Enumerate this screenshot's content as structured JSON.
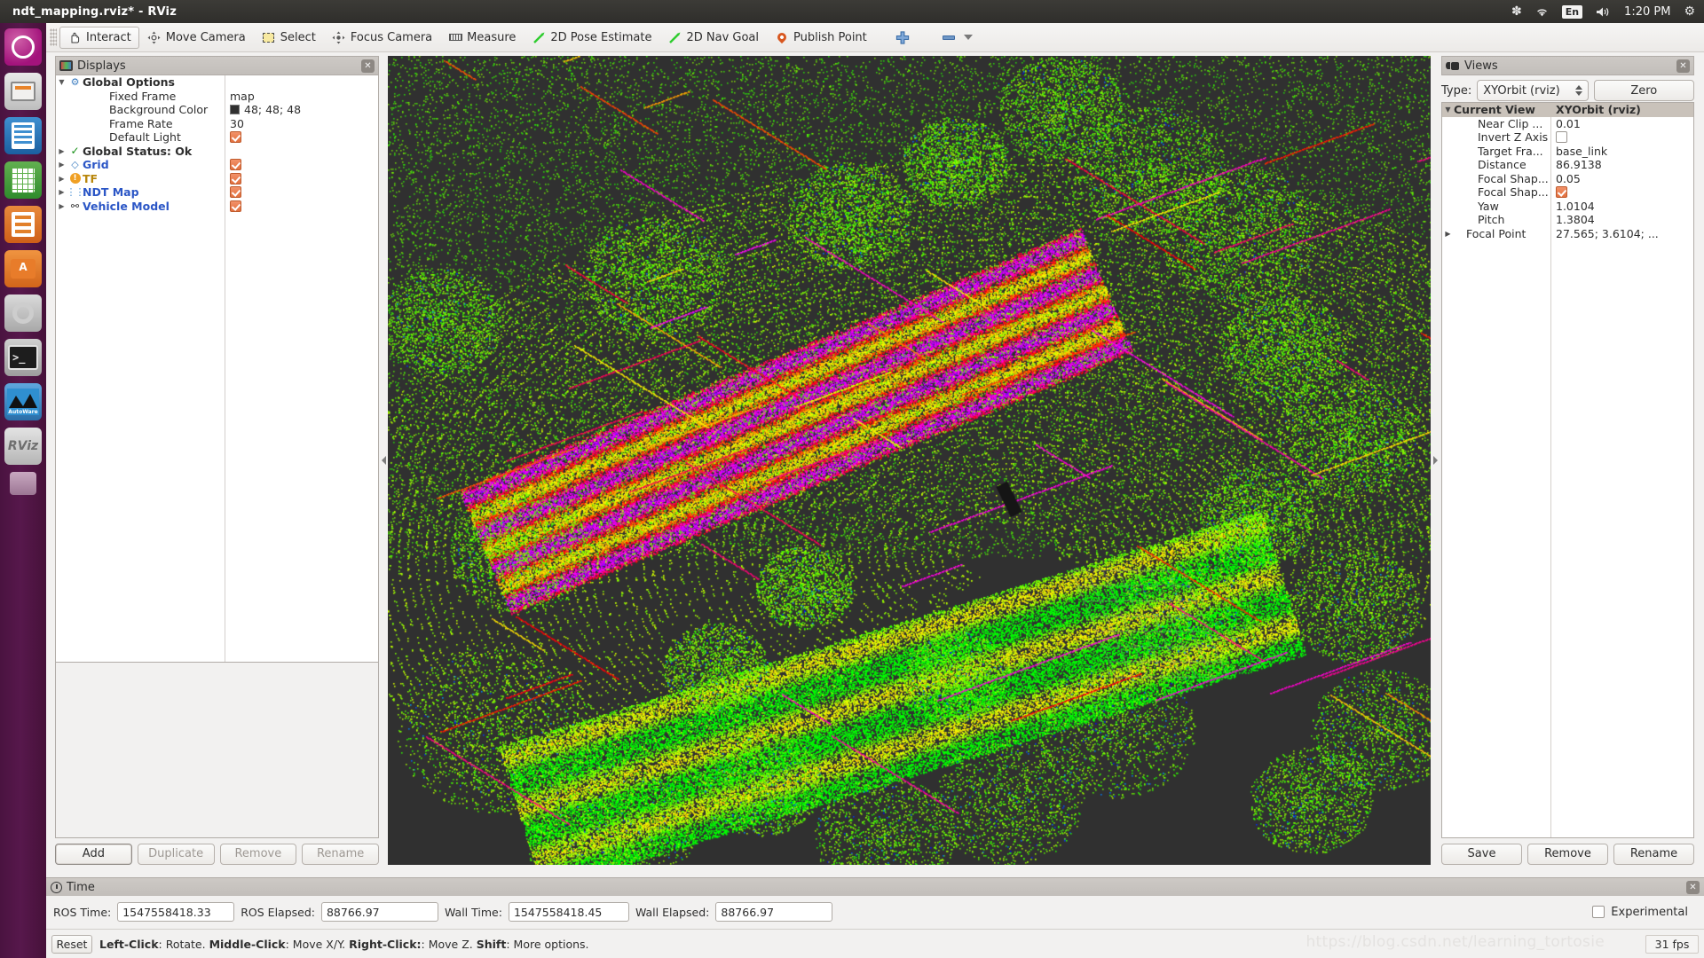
{
  "window": {
    "title": "ndt_mapping.rviz* - RViz"
  },
  "tray": {
    "items": [
      {
        "name": "sys-menu-icon",
        "glyph": "✽"
      },
      {
        "name": "wifi-icon",
        "glyph": "◔"
      },
      {
        "name": "keyboard-layout-indicator",
        "glyph": "En"
      },
      {
        "name": "volume-icon",
        "glyph": "🔊"
      }
    ],
    "clock": "1:20 PM",
    "session_icon": "⚙"
  },
  "launcher": {
    "items": [
      {
        "name": "ubuntu-dash-icon",
        "label": "Ubuntu"
      },
      {
        "name": "files-icon",
        "label": "Files"
      },
      {
        "name": "libreoffice-writer-icon",
        "label": "LibreOffice Writer"
      },
      {
        "name": "libreoffice-calc-icon",
        "label": "LibreOffice Calc"
      },
      {
        "name": "libreoffice-impress-icon",
        "label": "LibreOffice Impress"
      },
      {
        "name": "software-center-icon",
        "label": "Ubuntu Software"
      },
      {
        "name": "system-settings-icon",
        "label": "System Settings"
      },
      {
        "name": "terminal-icon",
        "label": "Terminal"
      },
      {
        "name": "autoware-icon",
        "label": "AutoWare"
      },
      {
        "name": "rviz-icon",
        "label": "RViz"
      },
      {
        "name": "screenshot-icon",
        "label": "Screenshot"
      }
    ]
  },
  "toolbar": {
    "buttons": [
      {
        "name": "tool-interact",
        "label": "Interact",
        "icon": "hand-icon",
        "active": true
      },
      {
        "name": "tool-move-camera",
        "label": "Move Camera",
        "icon": "move-camera-icon",
        "active": false
      },
      {
        "name": "tool-select",
        "label": "Select",
        "icon": "select-icon",
        "active": false
      },
      {
        "name": "tool-focus-camera",
        "label": "Focus Camera",
        "icon": "focus-camera-icon",
        "active": false
      },
      {
        "name": "tool-measure",
        "label": "Measure",
        "icon": "ruler-icon",
        "active": false
      },
      {
        "name": "tool-2d-pose-estimate",
        "label": "2D Pose Estimate",
        "icon": "green-arrow-icon",
        "active": false
      },
      {
        "name": "tool-2d-nav-goal",
        "label": "2D Nav Goal",
        "icon": "green-arrow-icon",
        "active": false
      },
      {
        "name": "tool-publish-point",
        "label": "Publish Point",
        "icon": "map-pin-icon",
        "active": false
      }
    ],
    "add_tool_label": "+",
    "remove_tool_label": "-"
  },
  "displays": {
    "title": "Displays",
    "close_label": "✕",
    "tree": [
      {
        "name": "global-options",
        "expander": "▼",
        "icon": "gear-icon",
        "label": "Global Options",
        "style": "bold",
        "value": "",
        "value_type": "none",
        "indent": false
      },
      {
        "name": "fixed-frame",
        "expander": "",
        "icon": "",
        "label": "Fixed Frame",
        "style": "plain",
        "value": "map",
        "value_type": "text",
        "indent": true
      },
      {
        "name": "background-color",
        "expander": "",
        "icon": "",
        "label": "Background Color",
        "style": "plain",
        "value": "48; 48; 48",
        "value_type": "color",
        "color": "#303030",
        "indent": true
      },
      {
        "name": "frame-rate",
        "expander": "",
        "icon": "",
        "label": "Frame Rate",
        "style": "plain",
        "value": "30",
        "value_type": "text",
        "indent": true
      },
      {
        "name": "default-light",
        "expander": "",
        "icon": "",
        "label": "Default Light",
        "style": "plain",
        "value": "",
        "value_type": "checkbox-on",
        "indent": true
      },
      {
        "name": "global-status",
        "expander": "▶",
        "icon": "check-icon",
        "label": "Global Status: Ok",
        "style": "bold",
        "value": "",
        "value_type": "none",
        "indent": false
      },
      {
        "name": "display-grid",
        "expander": "▶",
        "icon": "grid-icon",
        "label": "Grid",
        "style": "blue",
        "value": "",
        "value_type": "checkbox-on",
        "indent": false
      },
      {
        "name": "display-tf",
        "expander": "▶",
        "icon": "warning-icon",
        "label": "TF",
        "style": "warn",
        "value": "",
        "value_type": "checkbox-on",
        "indent": false
      },
      {
        "name": "display-ndt-map",
        "expander": "▶",
        "icon": "pointcloud-icon",
        "label": "NDT Map",
        "style": "blue",
        "value": "",
        "value_type": "checkbox-on",
        "indent": false
      },
      {
        "name": "display-vehicle-model",
        "expander": "▶",
        "icon": "vehicle-icon",
        "label": "Vehicle Model",
        "style": "blue",
        "value": "",
        "value_type": "checkbox-on",
        "indent": false
      }
    ],
    "buttons": [
      {
        "name": "add-display-button",
        "label": "Add",
        "disabled": false,
        "focus": true
      },
      {
        "name": "duplicate-display-button",
        "label": "Duplicate",
        "disabled": true,
        "focus": false
      },
      {
        "name": "remove-display-button",
        "label": "Remove",
        "disabled": true,
        "focus": false
      },
      {
        "name": "rename-display-button",
        "label": "Rename",
        "disabled": true,
        "focus": false
      }
    ]
  },
  "views": {
    "title": "Views",
    "close_label": "✕",
    "type_label": "Type:",
    "type_value": "XYOrbit (rviz)",
    "zero_label": "Zero",
    "header": {
      "name_col": "Current View",
      "value_col": "XYOrbit (rviz)",
      "expander": "▼"
    },
    "rows": [
      {
        "name": "near-clip-distance",
        "label": "Near Clip ...",
        "value": "0.01",
        "value_type": "text",
        "expander": ""
      },
      {
        "name": "invert-z-axis",
        "label": "Invert Z Axis",
        "value": "",
        "value_type": "checkbox-off",
        "expander": ""
      },
      {
        "name": "target-frame",
        "label": "Target Fra...",
        "value": "base_link",
        "value_type": "text",
        "expander": ""
      },
      {
        "name": "distance",
        "label": "Distance",
        "value": "86.9138",
        "value_type": "text",
        "expander": ""
      },
      {
        "name": "focal-shape-size",
        "label": "Focal Shap...",
        "value": "0.05",
        "value_type": "text",
        "expander": ""
      },
      {
        "name": "focal-shape-fixed-size",
        "label": "Focal Shap...",
        "value": "",
        "value_type": "checkbox-on",
        "expander": ""
      },
      {
        "name": "yaw",
        "label": "Yaw",
        "value": "1.0104",
        "value_type": "text",
        "expander": ""
      },
      {
        "name": "pitch",
        "label": "Pitch",
        "value": "1.3804",
        "value_type": "text",
        "expander": ""
      },
      {
        "name": "focal-point",
        "label": "Focal Point",
        "value": "27.565; 3.6104; ...",
        "value_type": "text",
        "expander": "▶"
      }
    ],
    "buttons": [
      {
        "name": "save-view-button",
        "label": "Save"
      },
      {
        "name": "remove-view-button",
        "label": "Remove"
      },
      {
        "name": "rename-view-button",
        "label": "Rename"
      }
    ]
  },
  "time_panel": {
    "title": "Time",
    "close_label": "✕",
    "fields": [
      {
        "name": "ros-time-field",
        "label": "ROS Time:",
        "value": "1547558418.33"
      },
      {
        "name": "ros-elapsed-field",
        "label": "ROS Elapsed:",
        "value": "88766.97"
      },
      {
        "name": "wall-time-field",
        "label": "Wall Time:",
        "value": "1547558418.45"
      },
      {
        "name": "wall-elapsed-field",
        "label": "Wall Elapsed:",
        "value": "88766.97"
      }
    ],
    "experimental_label": "Experimental"
  },
  "status_bar": {
    "reset_label": "Reset",
    "hint_parts": [
      {
        "strong": "Left-Click",
        "rest": ": Rotate. "
      },
      {
        "strong": "Middle-Click",
        "rest": ": Move X/Y. "
      },
      {
        "strong": "Right-Click:",
        "rest": ": Move Z. "
      },
      {
        "strong": "Shift",
        "rest": ": More options."
      }
    ],
    "fps": "31 fps",
    "watermark": "https://blog.csdn.net/learning_tortosie"
  },
  "viewport": {
    "name": "3d-render-view",
    "background_color": "#303030",
    "description": "NDT point cloud map rendered with rainbow intensity colormap"
  }
}
